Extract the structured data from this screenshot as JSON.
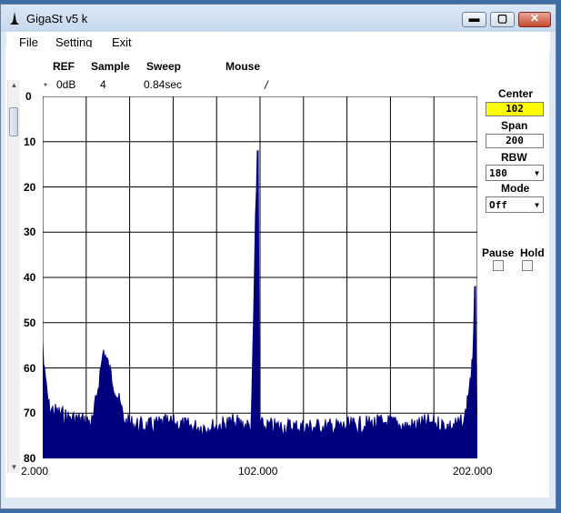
{
  "window": {
    "title": "GigaSt v5 k",
    "min_label": "▬",
    "max_label": "▢",
    "close_label": "✕"
  },
  "menu": [
    "File",
    "Setting",
    "Exit"
  ],
  "header": {
    "ref_label": "REF",
    "sample_label": "Sample",
    "sweep_label": "Sweep",
    "mouse_label": "Mouse",
    "ref_value": "0dB",
    "sample_value": "4",
    "sweep_value": "0.84sec",
    "mouse_value": "/",
    "marker": "*"
  },
  "controls": {
    "center_label": "Center",
    "center_value": "102",
    "span_label": "Span",
    "span_value": "200",
    "rbw_label": "RBW",
    "rbw_value": "180",
    "mode_label": "Mode",
    "mode_value": "Off",
    "pause_label": "Pause",
    "hold_label": "Hold"
  },
  "colors": {
    "trace": "#00007f",
    "center_box": "#ffff00"
  },
  "chart_data": {
    "type": "area",
    "y_ticks": [
      "0",
      "10",
      "20",
      "30",
      "40",
      "50",
      "60",
      "70",
      "80"
    ],
    "x_ticks": [
      "2.000",
      "102.000",
      "202.000"
    ],
    "xlim": [
      2,
      202
    ],
    "ylim": [
      0,
      80
    ],
    "y_inverted": true,
    "grid": true,
    "noise_floor_y": 73,
    "x": [
      2,
      2.5,
      3,
      5,
      14,
      25,
      30,
      40,
      50,
      60,
      70,
      80,
      90,
      98,
      100,
      101,
      101.5,
      102,
      103,
      110,
      120,
      140,
      160,
      170,
      180,
      190,
      196,
      200,
      201,
      201.5,
      202
    ],
    "y": [
      54,
      60,
      62,
      69,
      71,
      72,
      56,
      72,
      73,
      72,
      73,
      73,
      72,
      73,
      26,
      12,
      58,
      72,
      73,
      73,
      73,
      73,
      72,
      73,
      72,
      73,
      72,
      58,
      42,
      70,
      73
    ]
  }
}
